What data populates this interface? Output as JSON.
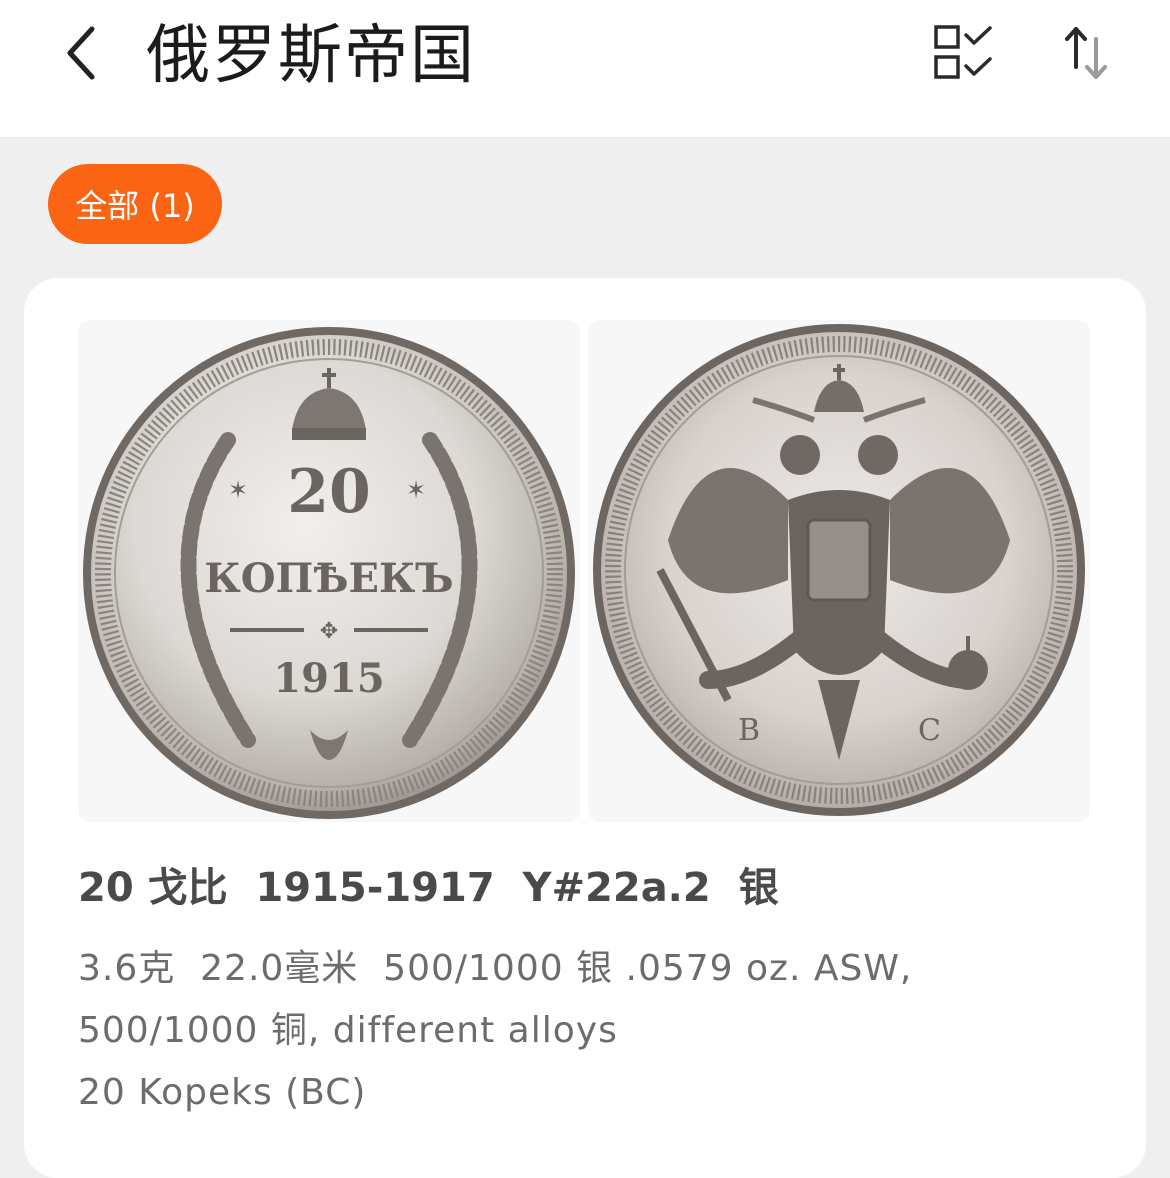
{
  "header": {
    "title": "俄罗斯帝国",
    "back_icon": "chevron-left-icon",
    "multi_select_icon": "checklist-icon",
    "sort_icon": "sort-arrows-icon"
  },
  "filter": {
    "chip_label": "全部 (1)",
    "chip_color": "#fb6412"
  },
  "coin": {
    "title": "20 戈比  1915-1917  Y#22a.2  银",
    "specs": "3.6克  22.0毫米  500/1000 银 .0579 oz. ASW, 500/1000 铜, different alloys",
    "name": "20 Kopeks (BC)",
    "obverse": {
      "denomination": "20",
      "word": "КОПѢЕКЪ",
      "year": "1915"
    },
    "reverse": {
      "mintmark_left": "В",
      "mintmark_right": "С"
    }
  }
}
